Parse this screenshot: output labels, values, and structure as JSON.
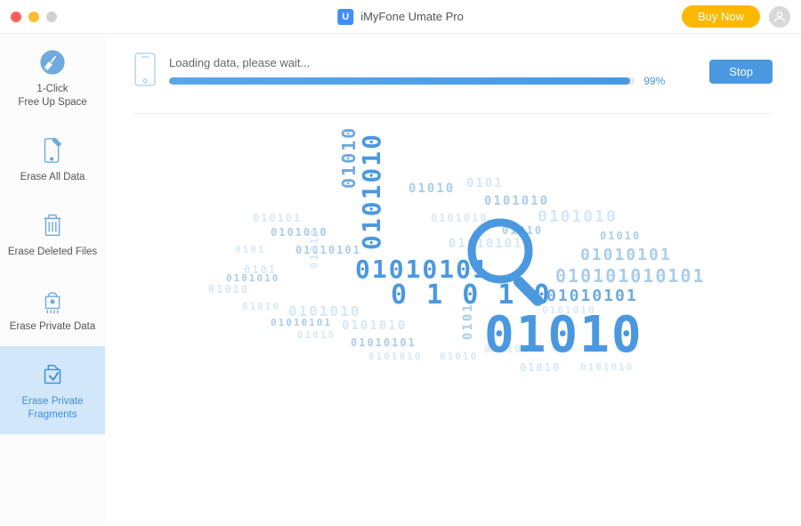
{
  "app": {
    "title": "iMyFone Umate Pro",
    "icon_letter": "U"
  },
  "titlebar": {
    "buy_now": "Buy Now"
  },
  "sidebar": {
    "items": [
      {
        "label": "1-Click\nFree Up Space",
        "icon": "broom"
      },
      {
        "label": "Erase All Data",
        "icon": "phone-erase"
      },
      {
        "label": "Erase Deleted Files",
        "icon": "trash"
      },
      {
        "label": "Erase Private Data",
        "icon": "lock-shred"
      },
      {
        "label": "Erase Private\nFragments",
        "icon": "fragments"
      }
    ],
    "active_index": 4
  },
  "loading": {
    "text": "Loading data, please wait...",
    "percent": 99,
    "percent_label": "99%",
    "stop_label": "Stop"
  },
  "colors": {
    "accent": "#4a98e0",
    "buy": "#ffb800"
  }
}
